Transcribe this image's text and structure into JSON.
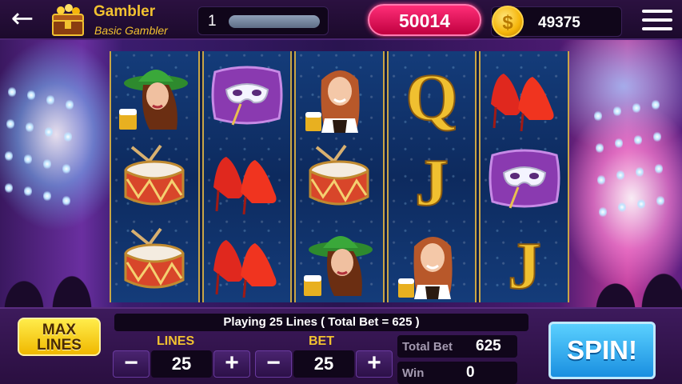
{
  "header": {
    "back_icon": "arrow-left-icon",
    "player_name": "Gambler",
    "player_rank": "Basic Gambler",
    "level": "1",
    "credits": "50014",
    "coin_symbol": "$",
    "coins": "49375",
    "menu_icon": "hamburger-menu-icon"
  },
  "reels": [
    [
      "woman-green-hat",
      "mask-pillow",
      "woman-beer"
    ],
    [
      "drum",
      "red-heels",
      "drum"
    ],
    [
      "red-heels",
      "drum",
      "woman-green-hat"
    ],
    [
      "letter-q",
      "letter-j",
      "woman-beer"
    ],
    [
      "red-heels",
      "mask-pillow",
      "letter-j"
    ]
  ],
  "reel_order": [
    [
      "woman-green-hat",
      "drum",
      "drum"
    ],
    [
      "mask-pillow",
      "red-heels",
      "red-heels"
    ],
    [
      "woman-beer",
      "drum",
      "woman-green-hat"
    ],
    [
      "letter-q",
      "letter-j",
      "woman-beer"
    ],
    [
      "red-heels",
      "mask-pillow",
      "letter-j"
    ]
  ],
  "controls": {
    "max_lines_line1": "MAX",
    "max_lines_line2": "LINES",
    "status_text": "Playing 25 Lines ( Total Bet = 625 )",
    "lines_label": "LINES",
    "lines_value": "25",
    "bet_label": "BET",
    "bet_value": "25",
    "minus": "−",
    "plus": "+",
    "total_bet_label": "Total Bet",
    "total_bet_value": "625",
    "win_label": "Win",
    "win_value": "0",
    "spin_label": "SPIN!"
  },
  "colors": {
    "gold": "#f2c230",
    "credits_pink": "#ff2e78",
    "spin_blue": "#1a8fe0",
    "reel_blue": "#0d2a5e"
  }
}
